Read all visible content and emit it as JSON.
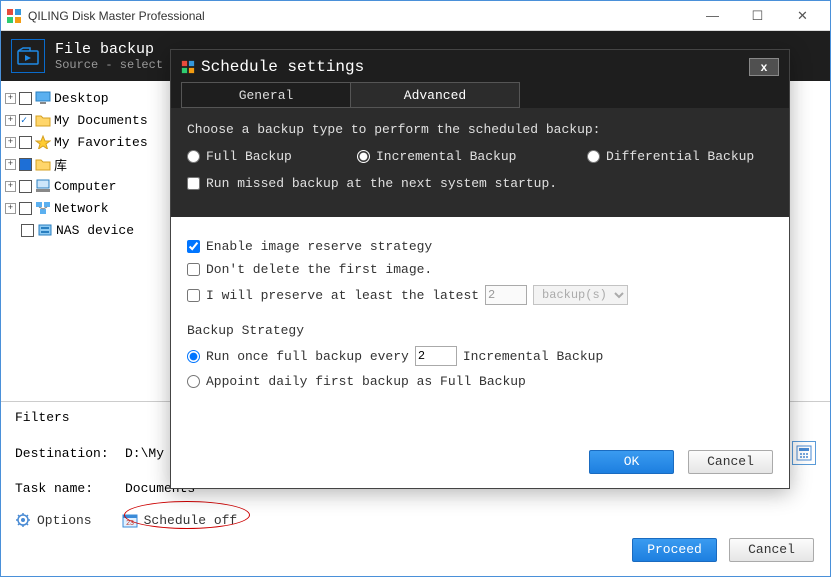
{
  "window": {
    "title": "QILING Disk Master Professional"
  },
  "ribbon": {
    "title": "File backup",
    "subtitle": "Source - select"
  },
  "tree": {
    "items": [
      {
        "exp": "+",
        "checked": false,
        "filled": false,
        "icon": "desktop",
        "label": "Desktop"
      },
      {
        "exp": "+",
        "checked": true,
        "filled": false,
        "icon": "folder",
        "label": "My Documents"
      },
      {
        "exp": "+",
        "checked": false,
        "filled": false,
        "icon": "star",
        "label": "My Favorites"
      },
      {
        "exp": "+",
        "checked": false,
        "filled": true,
        "icon": "folder",
        "label": "库"
      },
      {
        "exp": "+",
        "checked": false,
        "filled": false,
        "icon": "computer",
        "label": "Computer"
      },
      {
        "exp": "+",
        "checked": false,
        "filled": false,
        "icon": "network",
        "label": "Network"
      },
      {
        "exp": "",
        "checked": false,
        "filled": false,
        "icon": "nas",
        "label": "NAS device"
      }
    ]
  },
  "filters": {
    "label": "Filters"
  },
  "form": {
    "destination_label": "Destination:",
    "destination_value": "D:\\My Sto",
    "taskname_label": "Task name:",
    "taskname_value": "Documents"
  },
  "options": {
    "options_label": "Options",
    "schedule_label": "Schedule off"
  },
  "bottom": {
    "proceed": "Proceed",
    "cancel": "Cancel"
  },
  "modal": {
    "title": "Schedule settings",
    "tabs": {
      "general": "General",
      "advanced": "Advanced"
    },
    "prompt": "Choose a backup type to perform the scheduled backup:",
    "radio_full": "Full Backup",
    "radio_incremental": "Incremental Backup",
    "radio_differential": "Differential Backup",
    "run_missed": "Run missed backup at the next system startup.",
    "enable_reserve": "Enable image reserve strategy",
    "dont_delete": "Don't delete the first image.",
    "preserve_prefix": "I will preserve at least the latest",
    "preserve_value": "2",
    "preserve_unit": "backup(s)",
    "strategy_label": "Backup Strategy",
    "strategy_opt1_prefix": "Run once full backup every",
    "strategy_opt1_value": "2",
    "strategy_opt1_suffix": "Incremental Backup",
    "strategy_opt2": "Appoint daily first backup as Full Backup",
    "ok": "OK",
    "cancel": "Cancel"
  }
}
